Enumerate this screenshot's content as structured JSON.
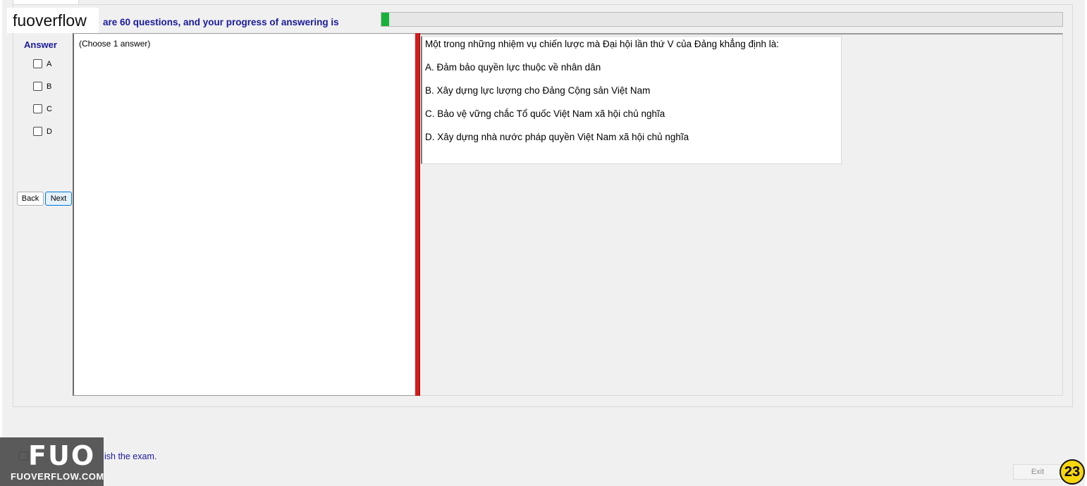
{
  "watermark": {
    "brand": "fuoverflow",
    "logo_big": "FUO",
    "logo_small": "FUOVERFLOW.COM"
  },
  "progress": {
    "text": "are 60 questions, and your progress of answering is",
    "fraction": 0.011
  },
  "answer_panel": {
    "label": "Answer",
    "options": [
      "A",
      "B",
      "C",
      "D"
    ],
    "back_label": "Back",
    "next_label": "Next"
  },
  "instruction": "(Choose 1 answer)",
  "question": {
    "text": "Một trong những nhiệm vụ chiến lược mà Đại hội lần thứ V của Đảng khẳng định là:",
    "choices": [
      "A.  Đảm bảo quyền lực thuộc về nhân dân",
      "B.  Xây dựng lực lượng cho Đảng Cộng sản Việt Nam",
      "C.  Bảo vệ vững chắc Tổ quốc Việt Nam xã hội chủ nghĩa",
      "D.  Xây dựng nhà nước pháp quyền Việt Nam xã hội chủ nghĩa"
    ]
  },
  "footer": {
    "finish_text": "ish the exam.",
    "exit_label": "Exit",
    "badge": "23"
  }
}
